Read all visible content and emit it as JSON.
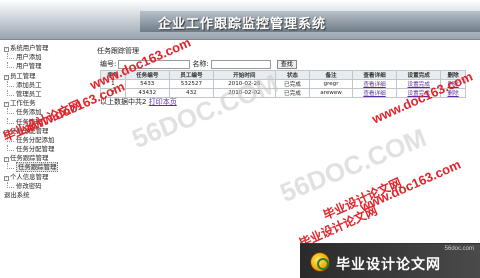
{
  "app_title": "企业工作跟踪监控管理系统",
  "sidebar": {
    "items": [
      {
        "label": "系统用户管理",
        "level": 0,
        "toggle": "-"
      },
      {
        "label": "用户添加",
        "level": 1
      },
      {
        "label": "用户管理",
        "level": 1
      },
      {
        "label": "员工管理",
        "level": 0,
        "toggle": "-"
      },
      {
        "label": "添加员工",
        "level": 1
      },
      {
        "label": "管理员工",
        "level": 1
      },
      {
        "label": "工作任务",
        "level": 0,
        "toggle": "-"
      },
      {
        "label": "任务添加",
        "level": 1
      },
      {
        "label": "任务管理",
        "level": 1
      },
      {
        "label": "任务分配管理",
        "level": 0,
        "toggle": "-"
      },
      {
        "label": "任务分配添加",
        "level": 1
      },
      {
        "label": "任务分配管理",
        "level": 1
      },
      {
        "label": "任务跟踪管理",
        "level": 0,
        "toggle": "-"
      },
      {
        "label": "任务跟踪管理",
        "level": 1,
        "selected": true
      },
      {
        "label": "个人信息管理",
        "level": 0,
        "toggle": "-"
      },
      {
        "label": "修改密码",
        "level": 1
      },
      {
        "label": "退出系统",
        "level": 0
      }
    ]
  },
  "main": {
    "section_title": "任务跟踪管理",
    "search": {
      "code_label": "编号:",
      "code_value": "",
      "name_label": "名称:",
      "name_value": "",
      "button_label": "查找"
    },
    "table": {
      "headers": [
        "序号",
        "任务编号",
        "员工编号",
        "开始时间",
        "状态",
        "备注",
        "查看详细",
        "设置完成",
        "删除"
      ],
      "rows": [
        [
          "1",
          "5433",
          "532527",
          "2010-02-26",
          "已完成",
          "gregr",
          "查看详细",
          "设置完成",
          "删除"
        ],
        [
          "2",
          "43432",
          "432",
          "2010-02-02",
          "已完成",
          "arewew",
          "查看详细",
          "设置完成",
          "删除"
        ]
      ]
    },
    "footer": {
      "summary": "以上数据中共2",
      "print_link": "打印本页"
    }
  },
  "watermarks": {
    "url": "www.doc163.com",
    "cn": "毕业设计论文网",
    "site56": "56DOC.COM"
  },
  "logo": {
    "site": "56doc.com",
    "name": "毕业设计论文网"
  },
  "colors": {
    "link": "#5b2ea0",
    "watermark_red": "#e0242a"
  }
}
